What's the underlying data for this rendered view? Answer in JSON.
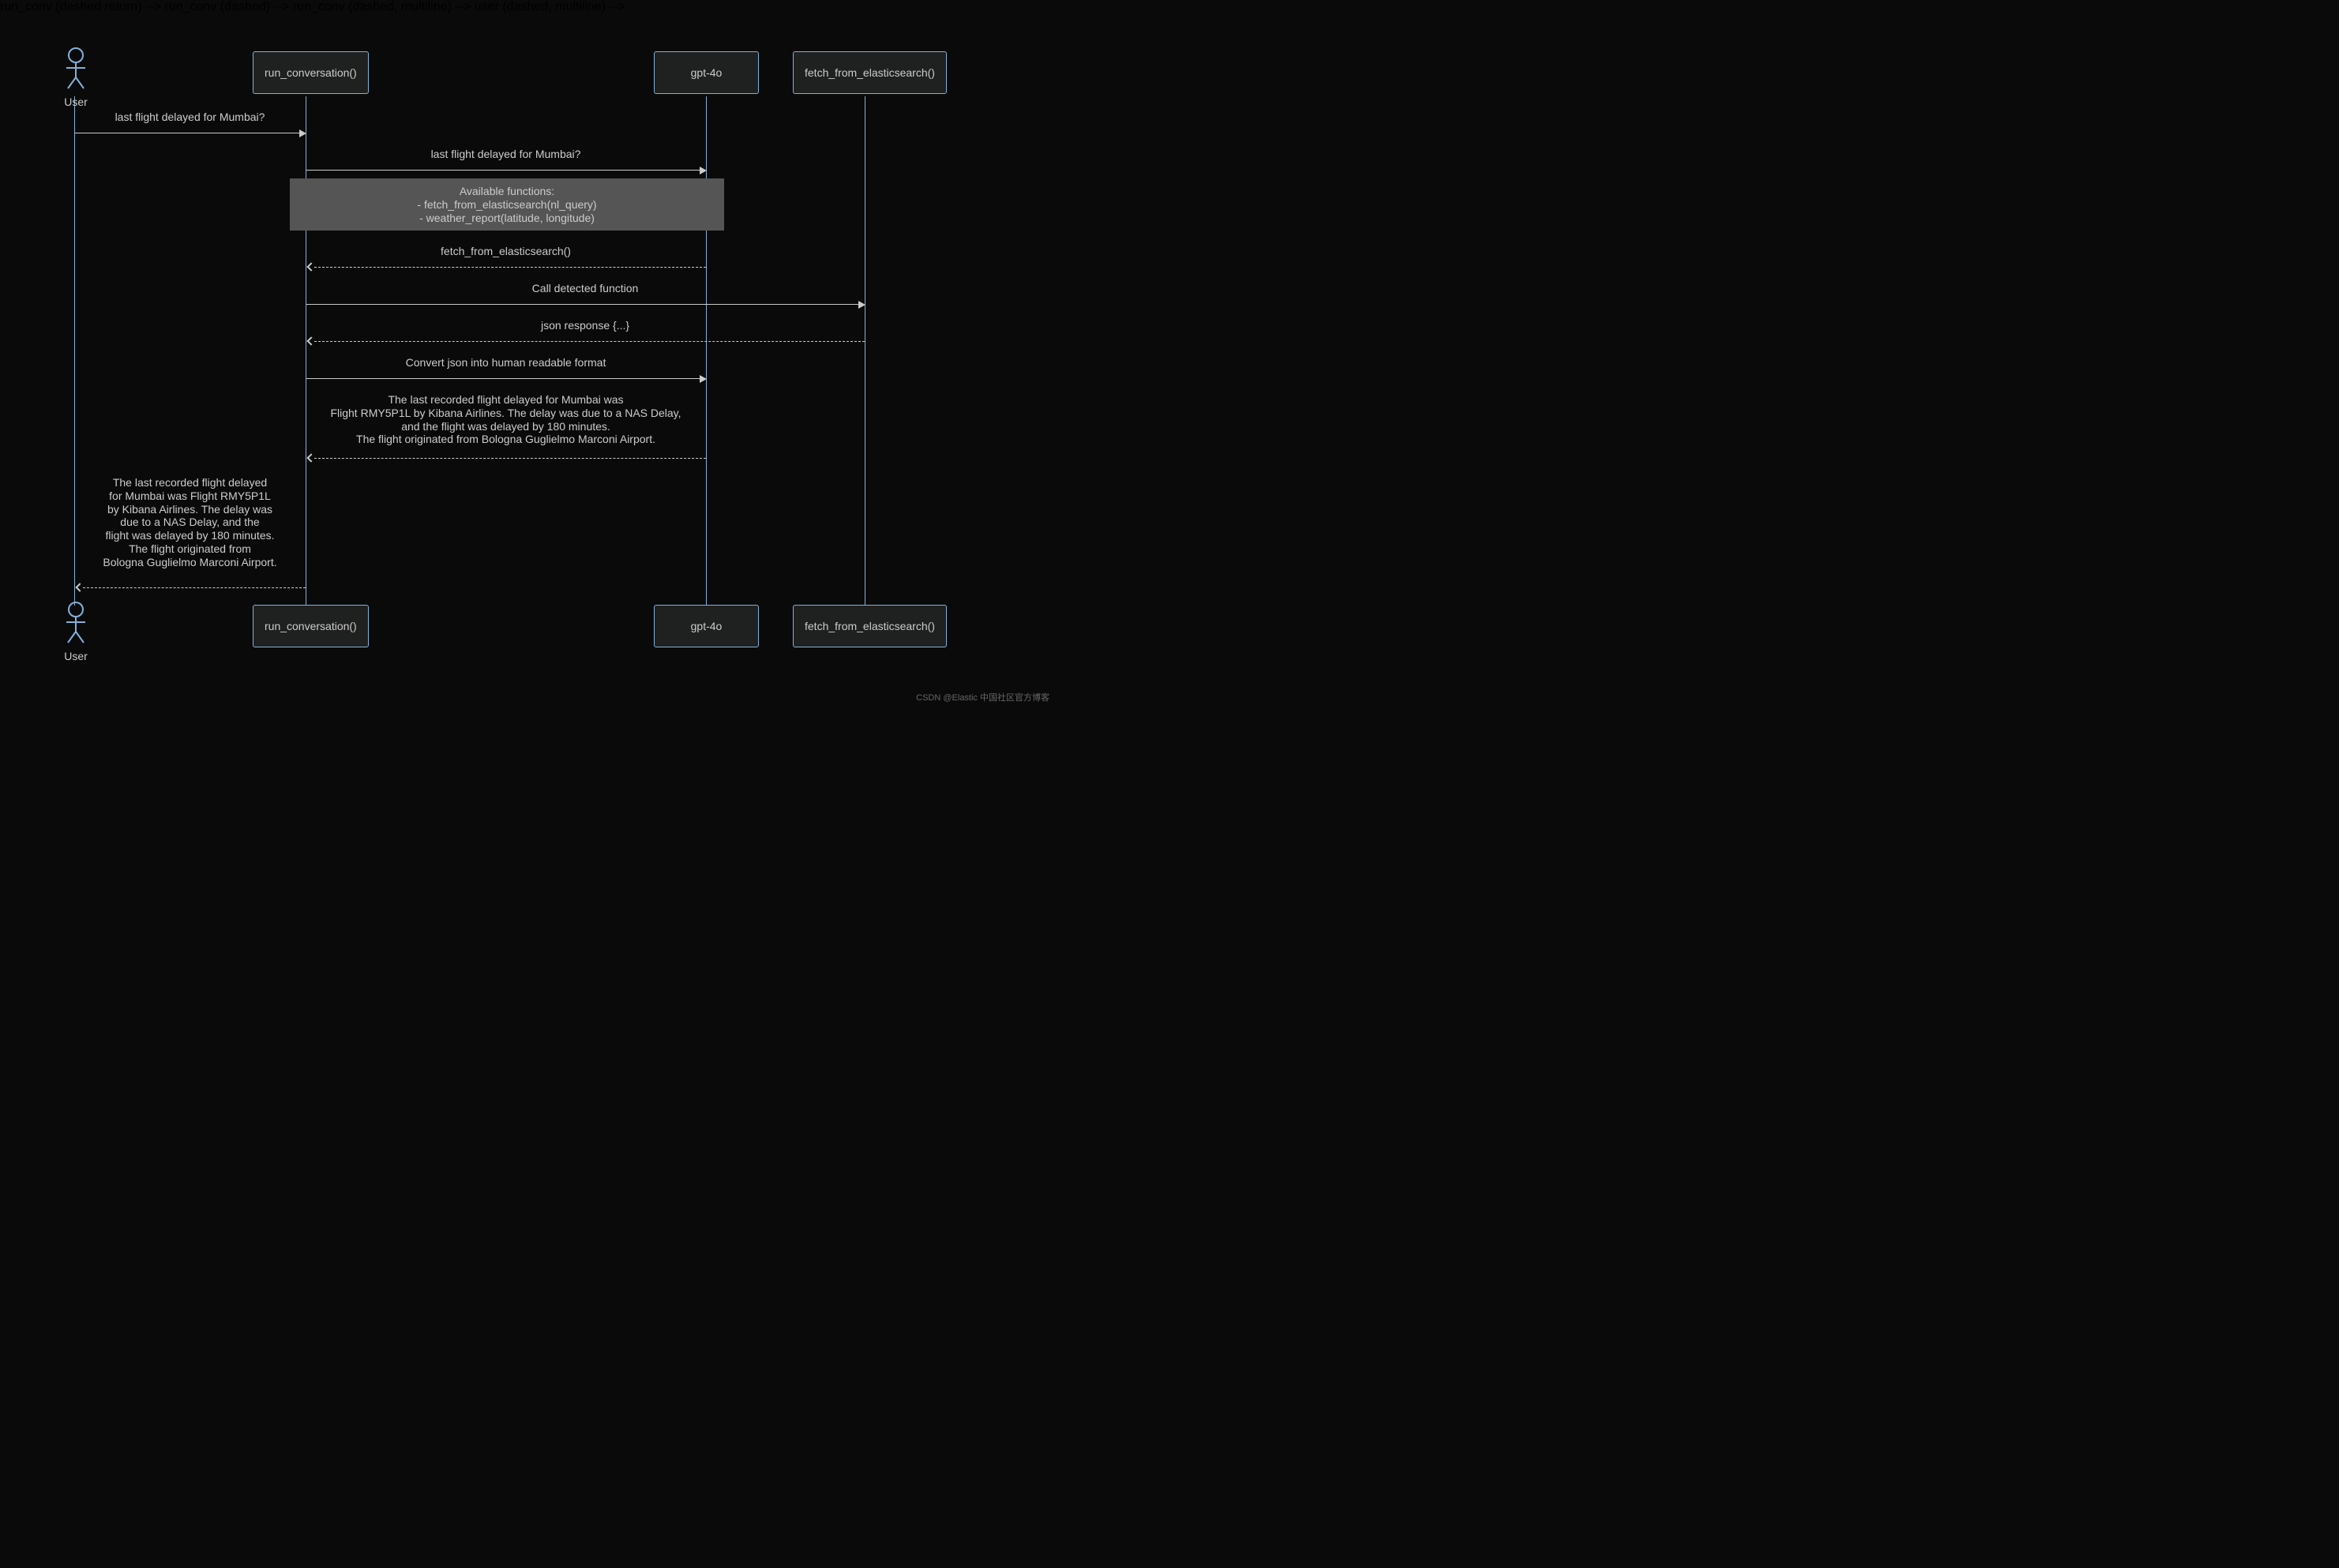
{
  "actors": {
    "user": "User"
  },
  "participants": {
    "run_conversation": "run_conversation()",
    "gpt": "gpt-4o",
    "fetch": "fetch_from_elasticsearch()"
  },
  "messages": {
    "m1": "last flight delayed for Mumbai?",
    "m2": "last flight delayed for Mumbai?",
    "note_line1": "Available functions:",
    "note_line2": "- fetch_from_elasticsearch(nl_query)",
    "note_line3": "- weather_report(latitude, longitude)",
    "m3": "fetch_from_elasticsearch()",
    "m4": "Call detected function",
    "m5": "json response {...}",
    "m6": "Convert json into human readable format",
    "m7_line1": "The last recorded flight delayed for Mumbai was",
    "m7_line2": "Flight RMY5P1L by Kibana Airlines. The delay was due to a NAS Delay,",
    "m7_line3": "and the flight was delayed by 180 minutes.",
    "m7_line4": "The flight originated from Bologna Guglielmo Marconi Airport.",
    "m8_line1": "The last recorded flight delayed",
    "m8_line2": "for Mumbai was Flight RMY5P1L",
    "m8_line3": "by Kibana Airlines. The delay was",
    "m8_line4": "due to a NAS Delay, and the",
    "m8_line5": "flight was delayed by 180 minutes.",
    "m8_line6": "The flight originated from",
    "m8_line7": "Bologna Guglielmo Marconi Airport."
  },
  "watermark": "CSDN @Elastic 中国社区官方博客"
}
